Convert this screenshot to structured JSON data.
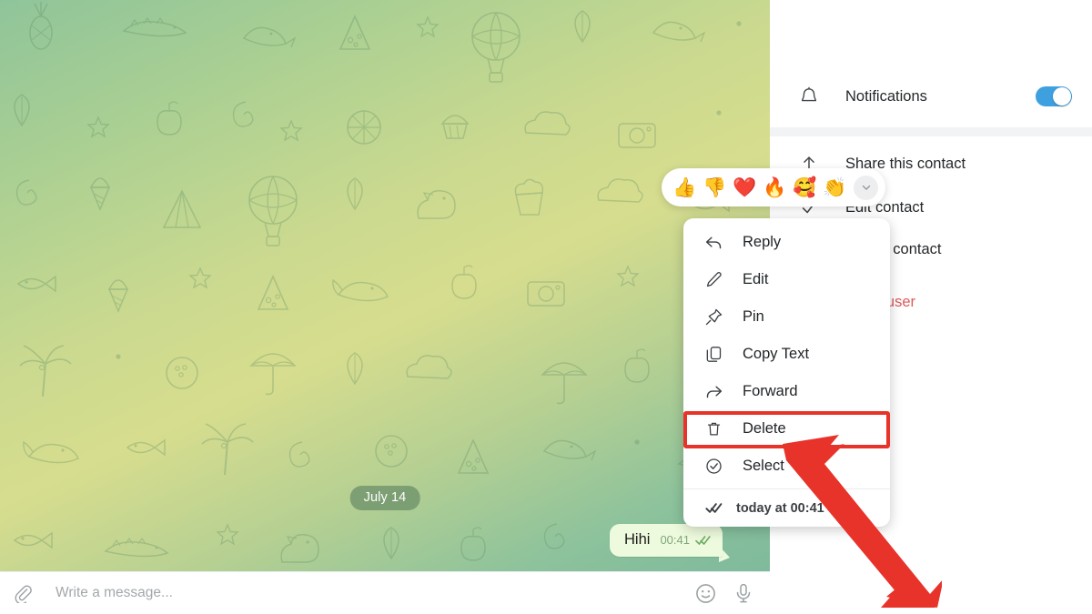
{
  "chat": {
    "date_divider": "July 14",
    "message": {
      "text": "Hihi",
      "time": "00:41",
      "status_icon": "double-check-icon"
    },
    "composer": {
      "placeholder": "Write a message...",
      "value": "",
      "attach_icon": "paperclip-icon",
      "emoji_icon": "smiley-icon",
      "voice_icon": "microphone-icon"
    }
  },
  "reactions": {
    "items": [
      {
        "emoji": "👍",
        "name": "thumbs-up-reaction"
      },
      {
        "emoji": "👎",
        "name": "thumbs-down-reaction"
      },
      {
        "emoji": "❤️",
        "name": "heart-reaction"
      },
      {
        "emoji": "🔥",
        "name": "fire-reaction"
      },
      {
        "emoji": "🥰",
        "name": "smiling-hearts-reaction"
      },
      {
        "emoji": "👏",
        "name": "clap-reaction"
      }
    ],
    "more_icon": "chevron-down-icon"
  },
  "context_menu": {
    "items": [
      {
        "label": "Reply",
        "icon": "reply-icon"
      },
      {
        "label": "Edit",
        "icon": "pencil-icon"
      },
      {
        "label": "Pin",
        "icon": "pin-icon"
      },
      {
        "label": "Copy Text",
        "icon": "copy-icon"
      },
      {
        "label": "Forward",
        "icon": "forward-icon"
      },
      {
        "label": "Delete",
        "icon": "trash-icon"
      },
      {
        "label": "Select",
        "icon": "check-circle-icon"
      }
    ],
    "footer": {
      "label": "today at 00:41",
      "icon": "double-check-icon"
    },
    "highlighted_item": "Delete",
    "highlight_color": "#e8332a"
  },
  "sidebar": {
    "notifications": {
      "label": "Notifications",
      "icon": "bell-icon",
      "enabled": true,
      "accent": "#3fa0e0"
    },
    "actions": [
      {
        "label": "Share this contact",
        "icon": "share-icon",
        "danger": false
      },
      {
        "label": "Edit contact",
        "icon": "check-icon",
        "danger": false
      },
      {
        "label": "Delete contact",
        "icon": "trash-icon",
        "danger": false
      },
      {
        "label": "Block user",
        "icon": "block-icon",
        "danger": true
      }
    ]
  },
  "annotation": {
    "arrow_color": "#e8332a",
    "arrow_name": "pointer-arrow"
  }
}
